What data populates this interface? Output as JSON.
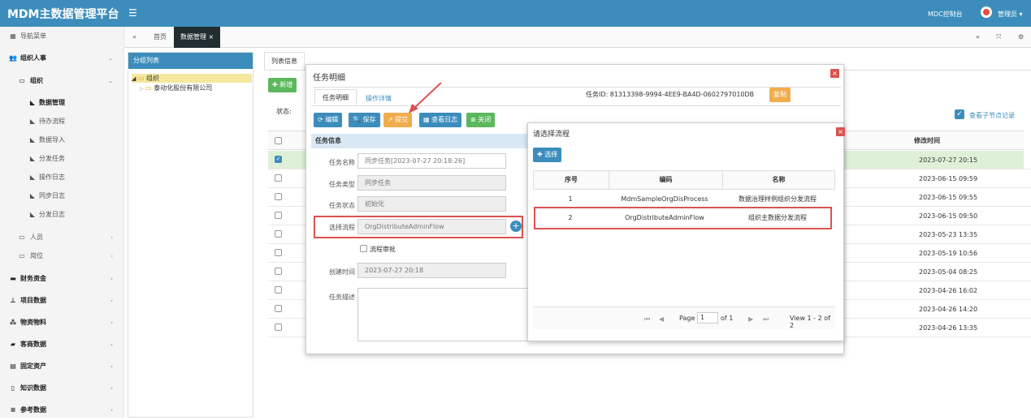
{
  "header": {
    "app_title": "MDM主数据管理平台",
    "menu_icon": "hamburger-icon",
    "console": "MDC控制台",
    "user": "管理员 ▾",
    "brand_color": "#3c8dbc"
  },
  "sidebar": {
    "nav_menu": "导航菜单",
    "items": [
      {
        "label": "组织人事",
        "icon": "users-icon"
      },
      {
        "label": "组织",
        "icon": "folder-icon"
      },
      {
        "label": "数据管理",
        "icon": "tag-icon"
      },
      {
        "label": "待办流程",
        "icon": "tag-icon"
      },
      {
        "label": "数据导入",
        "icon": "tag-icon"
      },
      {
        "label": "分发任务",
        "icon": "tag-icon"
      },
      {
        "label": "操作日志",
        "icon": "tag-icon"
      },
      {
        "label": "同步日志",
        "icon": "tag-icon"
      },
      {
        "label": "分发日志",
        "icon": "tag-icon"
      },
      {
        "label": "人员",
        "icon": "folder-icon"
      },
      {
        "label": "岗位",
        "icon": "folder-icon"
      },
      {
        "label": "财务资金",
        "icon": "money-icon"
      },
      {
        "label": "项目数据",
        "icon": "sitemap-icon"
      },
      {
        "label": "物资物料",
        "icon": "cubes-icon"
      },
      {
        "label": "客商数据",
        "icon": "car-icon"
      },
      {
        "label": "固定资产",
        "icon": "building-icon"
      },
      {
        "label": "知识数据",
        "icon": "book-icon"
      },
      {
        "label": "参考数据",
        "icon": "list-icon"
      }
    ]
  },
  "tabs": {
    "home": "首页",
    "data_mgmt": "数据管理"
  },
  "tree": {
    "title": "分组列表",
    "root": "组织",
    "child": "泰动化股份有限公司"
  },
  "main": {
    "tab": "列表信息",
    "add": "新增",
    "status_label": "状态:",
    "show_child": "查看子节点记录",
    "col_modified": "修改时间",
    "rows": [
      "2023-07-27 20:15",
      "2023-06-15 09:59",
      "2023-06-15 09:55",
      "2023-06-15 09:50",
      "2023-05-23 13:35",
      "2023-05-19 10:56",
      "2023-05-04 08:25",
      "2023-04-26 16:02",
      "2023-04-26 14:20",
      "2023-04-26 13:35"
    ]
  },
  "dlg1": {
    "title": "任务明细",
    "tab1": "任务明细",
    "tab2": "操作详情",
    "task_id": "任务ID: 81313398-9994-4EE9-BA4D-0602797010DB",
    "copy": "复制",
    "btn_edit": "编辑",
    "btn_save": "保存",
    "btn_submit": "提交",
    "btn_log": "查看日志",
    "btn_close": "关闭",
    "section": "任务信息",
    "f_name_l": "任务名称",
    "f_name": "同步任务[2023-07-27 20:18:26]",
    "f_type_l": "任务类型",
    "f_type": "同步任务",
    "f_status_l": "任务状态",
    "f_status": "初始化",
    "f_flow_l": "选择流程",
    "f_flow": "OrgDistributeAdminFlow",
    "f_approve": "流程审批",
    "f_time_l": "创建时间",
    "f_time": "2023-07-27 20:18",
    "f_desc_l": "任务描述"
  },
  "dlg2": {
    "title": "请选择流程",
    "select": "选择",
    "cols": [
      "序号",
      "编码",
      "名称"
    ],
    "rows": [
      [
        "1",
        "MdmSampleOrgDisProcess",
        "数据治理样例组织分发流程"
      ],
      [
        "2",
        "OrgDistributeAdminFlow",
        "组织主数据分发流程"
      ]
    ],
    "page": "Page",
    "page_num": "1",
    "of": "of 1",
    "view": "View 1 - 2 of 2"
  }
}
